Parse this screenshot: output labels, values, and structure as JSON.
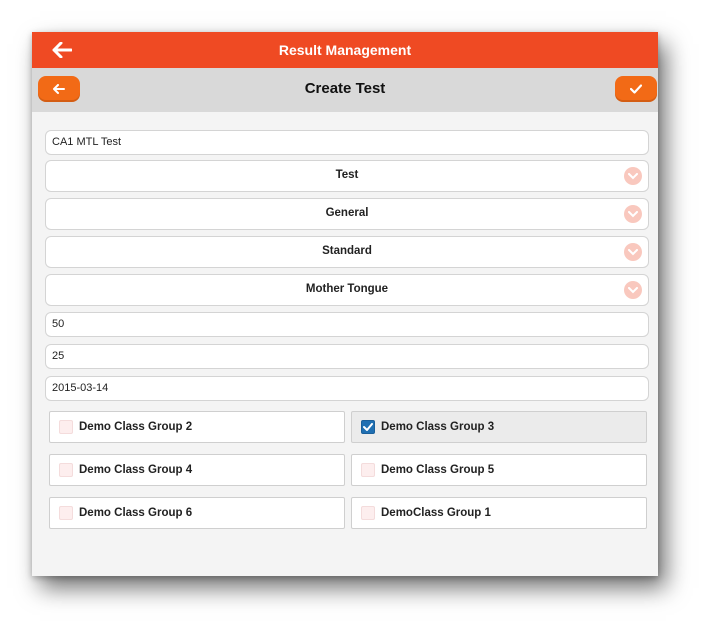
{
  "header": {
    "title": "Result Management",
    "back_icon": "arrow-left-icon"
  },
  "subheader": {
    "title": "Create Test",
    "back_icon": "arrow-left-icon",
    "confirm_icon": "check-icon"
  },
  "form": {
    "test_name": "CA1 MTL Test",
    "type_select": "Test",
    "category_select": "General",
    "level_select": "Standard",
    "subject_select": "Mother Tongue",
    "max_marks": "50",
    "pass_marks": "25",
    "date": "2015-03-14"
  },
  "class_groups": [
    {
      "label": "Demo Class Group 2",
      "checked": false
    },
    {
      "label": "Demo Class Group 3",
      "checked": true
    },
    {
      "label": "Demo Class Group 4",
      "checked": false
    },
    {
      "label": "Demo Class Group 5",
      "checked": false
    },
    {
      "label": "Demo Class Group 6",
      "checked": false
    },
    {
      "label": "DemoClass Group 1",
      "checked": false
    }
  ],
  "colors": {
    "header": "#ef4a23",
    "button": "#f26a16",
    "check": "#1f6fb2"
  }
}
